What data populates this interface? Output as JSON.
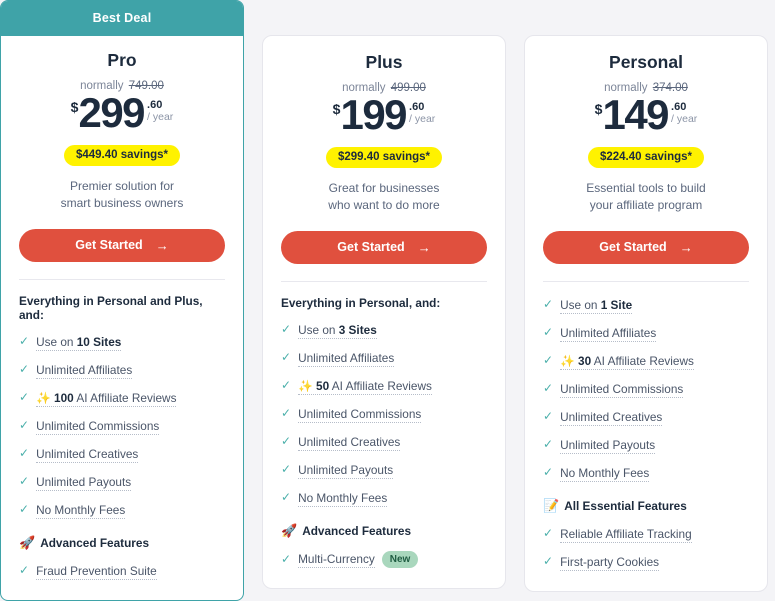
{
  "page": {
    "background_color": "#f4f4f7",
    "accent_teal": "#3fa3a8",
    "accent_red": "#e0503e",
    "savings_yellow": "#fff200",
    "badge_green": "#a9d7bd"
  },
  "plans": [
    {
      "featured": true,
      "ribbon_label": "Best Deal",
      "name": "Pro",
      "normally_label": "normally",
      "normally_price": "749.00",
      "currency": "$",
      "price": "299",
      "cents": ".60",
      "period": "/ year",
      "savings": "$449.40 savings*",
      "tagline_line1": "Premier solution for",
      "tagline_line2": "smart business owners",
      "cta_label": "Get Started",
      "cta_arrow": "→",
      "groups": [
        {
          "heading": "Everything in Personal and Plus, and:",
          "heading_emoji": "",
          "features": [
            {
              "prefix": "Use on ",
              "em": "10 Sites",
              "suffix": "",
              "emoji": "",
              "badge": ""
            },
            {
              "prefix": "",
              "em": "",
              "suffix": "Unlimited Affiliates",
              "emoji": "",
              "badge": ""
            },
            {
              "prefix": "",
              "em": "100",
              "suffix": " AI Affiliate Reviews",
              "emoji": "✨",
              "badge": ""
            },
            {
              "prefix": "",
              "em": "",
              "suffix": "Unlimited Commissions",
              "emoji": "",
              "badge": ""
            },
            {
              "prefix": "",
              "em": "",
              "suffix": "Unlimited Creatives",
              "emoji": "",
              "badge": ""
            },
            {
              "prefix": "",
              "em": "",
              "suffix": "Unlimited Payouts",
              "emoji": "",
              "badge": ""
            },
            {
              "prefix": "",
              "em": "",
              "suffix": "No Monthly Fees",
              "emoji": "",
              "badge": ""
            }
          ]
        },
        {
          "heading": "Advanced Features",
          "heading_emoji": "🚀",
          "features": [
            {
              "prefix": "",
              "em": "",
              "suffix": "Fraud Prevention Suite",
              "emoji": "",
              "badge": ""
            }
          ]
        }
      ]
    },
    {
      "featured": false,
      "ribbon_label": "",
      "name": "Plus",
      "normally_label": "normally",
      "normally_price": "499.00",
      "currency": "$",
      "price": "199",
      "cents": ".60",
      "period": "/ year",
      "savings": "$299.40 savings*",
      "tagline_line1": "Great for businesses",
      "tagline_line2": "who want to do more",
      "cta_label": "Get Started",
      "cta_arrow": "→",
      "groups": [
        {
          "heading": "Everything in Personal, and:",
          "heading_emoji": "",
          "features": [
            {
              "prefix": "Use on ",
              "em": "3 Sites",
              "suffix": "",
              "emoji": "",
              "badge": ""
            },
            {
              "prefix": "",
              "em": "",
              "suffix": "Unlimited Affiliates",
              "emoji": "",
              "badge": ""
            },
            {
              "prefix": "",
              "em": "50",
              "suffix": " AI Affiliate Reviews",
              "emoji": "✨",
              "badge": ""
            },
            {
              "prefix": "",
              "em": "",
              "suffix": "Unlimited Commissions",
              "emoji": "",
              "badge": ""
            },
            {
              "prefix": "",
              "em": "",
              "suffix": "Unlimited Creatives",
              "emoji": "",
              "badge": ""
            },
            {
              "prefix": "",
              "em": "",
              "suffix": "Unlimited Payouts",
              "emoji": "",
              "badge": ""
            },
            {
              "prefix": "",
              "em": "",
              "suffix": "No Monthly Fees",
              "emoji": "",
              "badge": ""
            }
          ]
        },
        {
          "heading": "Advanced Features",
          "heading_emoji": "🚀",
          "features": [
            {
              "prefix": "",
              "em": "",
              "suffix": "Multi-Currency",
              "emoji": "",
              "badge": "New"
            }
          ]
        }
      ]
    },
    {
      "featured": false,
      "ribbon_label": "",
      "name": "Personal",
      "normally_label": "normally",
      "normally_price": "374.00",
      "currency": "$",
      "price": "149",
      "cents": ".60",
      "period": "/ year",
      "savings": "$224.40 savings*",
      "tagline_line1": "Essential tools to build",
      "tagline_line2": "your affiliate program",
      "cta_label": "Get Started",
      "cta_arrow": "→",
      "groups": [
        {
          "heading": "",
          "heading_emoji": "",
          "features": [
            {
              "prefix": "Use on ",
              "em": "1 Site",
              "suffix": "",
              "emoji": "",
              "badge": ""
            },
            {
              "prefix": "",
              "em": "",
              "suffix": "Unlimited Affiliates",
              "emoji": "",
              "badge": ""
            },
            {
              "prefix": "",
              "em": "30",
              "suffix": " AI Affiliate Reviews",
              "emoji": "✨",
              "badge": ""
            },
            {
              "prefix": "",
              "em": "",
              "suffix": "Unlimited Commissions",
              "emoji": "",
              "badge": ""
            },
            {
              "prefix": "",
              "em": "",
              "suffix": "Unlimited Creatives",
              "emoji": "",
              "badge": ""
            },
            {
              "prefix": "",
              "em": "",
              "suffix": "Unlimited Payouts",
              "emoji": "",
              "badge": ""
            },
            {
              "prefix": "",
              "em": "",
              "suffix": "No Monthly Fees",
              "emoji": "",
              "badge": ""
            }
          ]
        },
        {
          "heading": "All Essential Features",
          "heading_emoji": "📝",
          "features": [
            {
              "prefix": "",
              "em": "",
              "suffix": "Reliable Affiliate Tracking",
              "emoji": "",
              "badge": ""
            },
            {
              "prefix": "",
              "em": "",
              "suffix": "First-party Cookies",
              "emoji": "",
              "badge": ""
            }
          ]
        }
      ]
    }
  ],
  "icons": {
    "check": "✓",
    "arrow_right": "→",
    "sparkles": "✨",
    "rocket": "🚀",
    "memo": "📝"
  }
}
